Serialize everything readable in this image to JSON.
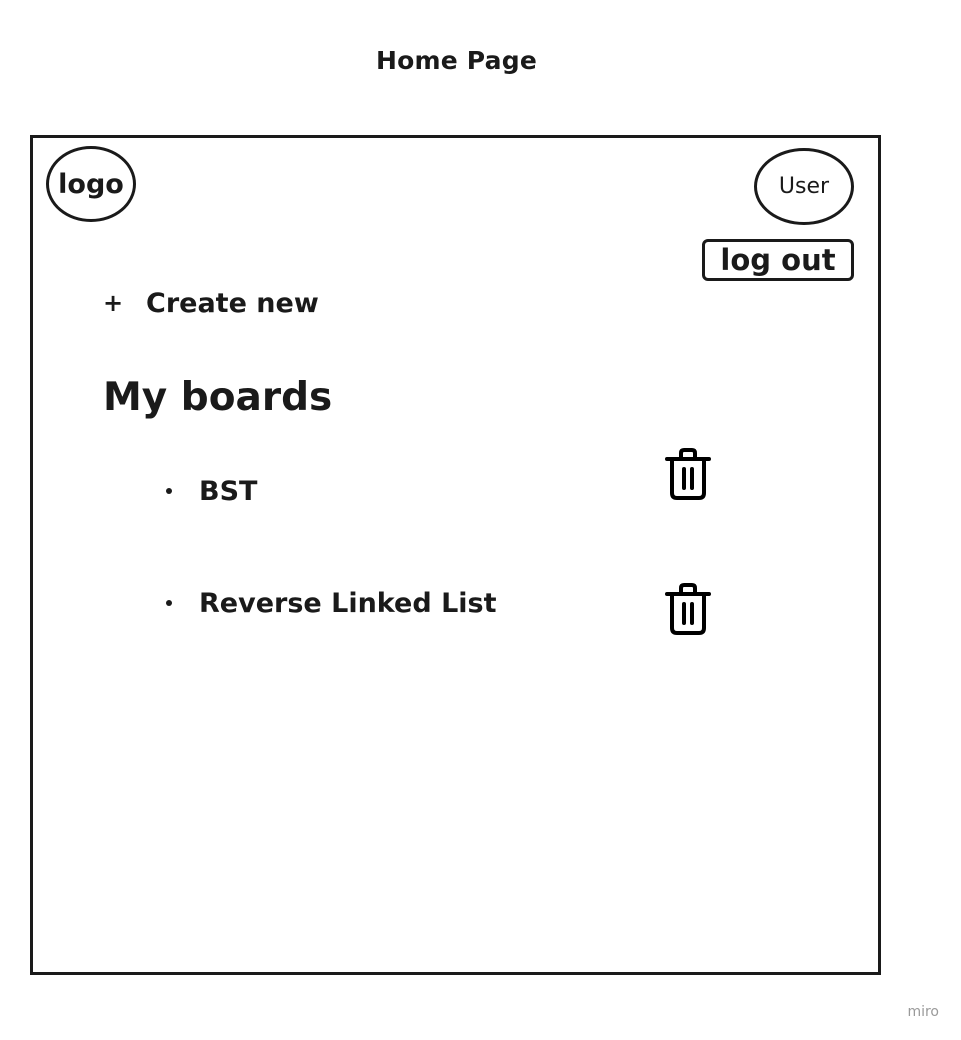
{
  "page": {
    "title": "Home Page"
  },
  "header": {
    "logo_label": "logo",
    "user_label": "User",
    "logout_label": "log out"
  },
  "actions": {
    "create_new_icon": "+",
    "create_new_label": "Create new"
  },
  "boards": {
    "heading": "My boards",
    "items": [
      {
        "name": "BST",
        "delete_icon": "trash-icon"
      },
      {
        "name": "Reverse Linked List",
        "delete_icon": "trash-icon"
      }
    ]
  },
  "watermark": "miro"
}
